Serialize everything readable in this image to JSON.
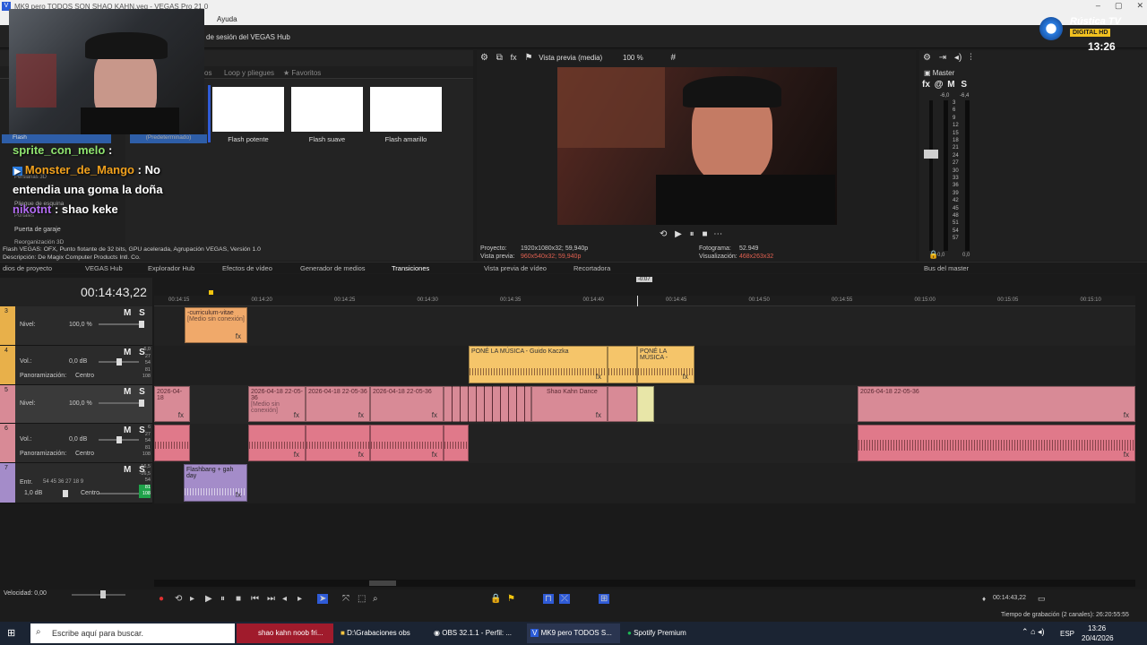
{
  "window": {
    "title": "MK9 pero TODOS SON SHAO KAHN.veg - VEGAS Pro 21.0",
    "menu_help": "Ayuda",
    "hub_text": "de sesión del VEGAS Hub"
  },
  "overlay": {
    "brand": "Rústica TV",
    "brand_sub": "DIGITAL HD",
    "clock": "13:26",
    "chat": [
      {
        "user": "sprite_con_melo",
        "text": ":"
      },
      {
        "user": "Monster_de_Mango",
        "text": ": No"
      },
      {
        "user": "",
        "text": "entendia una goma la doña"
      },
      {
        "user": "nikotnt",
        "text": ": shao keke"
      }
    ]
  },
  "transitions": {
    "tabs": [
      "os",
      "Loop y pliegues",
      "Favoritos"
    ],
    "tiles": [
      "Flash potente",
      "Flash suave",
      "Flash amarillo"
    ],
    "left_list": [
      "Flash",
      "(Predeterminado)",
      "Persianas 3D",
      "Pliegue de esquina",
      "Portales",
      "Puerta de garaje",
      "Reorganización 3D"
    ],
    "info1": "Flash VEGAS: OFX, Punto flotante de 32 bits, GPU acelerada, Agrupación VEGAS, Versión 1.0",
    "info2": "Descripción: De Magix Computer Products Intl. Co."
  },
  "tabs": {
    "bottom": [
      "dios de proyecto",
      "VEGAS Hub",
      "Explorador Hub",
      "Efectos de vídeo",
      "Generador de medios",
      "Transiciones"
    ],
    "preview": [
      "Vista previa de vídeo",
      "Recortadora"
    ],
    "master": "Bus del master"
  },
  "preview": {
    "mode": "Vista previa (media)",
    "zoom": "100 %",
    "proyecto_label": "Proyecto:",
    "proyecto_val": "1920x1080x32; 59,940p",
    "vista_label": "Vista previa:",
    "vista_val": "960x540x32; 59,940p",
    "fotograma_label": "Fotograma:",
    "fotograma_val": "52.949",
    "visual_label": "Visualización:",
    "visual_val": "468x263x32"
  },
  "master": {
    "title": "Master",
    "buttons": [
      "fx",
      "M",
      "S"
    ],
    "scale": [
      "-6,0",
      "-6,4",
      "3",
      "6",
      "9",
      "12",
      "15",
      "18",
      "21",
      "24",
      "27",
      "30",
      "33",
      "36",
      "39",
      "42",
      "45",
      "48",
      "51",
      "54",
      "57"
    ],
    "bottom": [
      "0,0",
      "0,0"
    ]
  },
  "timeline": {
    "timecode": "00:14:43,22",
    "cursor_label": "-0:07",
    "ticks": [
      "00:14:15",
      "00:14:20",
      "00:14:25",
      "00:14:30",
      "00:14:35",
      "00:14:40",
      "00:14:45",
      "00:14:50",
      "00:14:55",
      "00:15:00",
      "00:15:05",
      "00:15:10"
    ],
    "tracks": [
      {
        "num": "3",
        "kind": "video",
        "label": "Nivel:",
        "value": "100,0 %"
      },
      {
        "num": "4",
        "kind": "audio",
        "label": "Vol.:",
        "value": "0,0 dB",
        "pan_label": "Panoramización:",
        "pan": "Centro",
        "meter": [
          "-6,0",
          "27",
          "54",
          "81",
          "108"
        ]
      },
      {
        "num": "5",
        "kind": "video",
        "label": "Nivel:",
        "value": "100,0 %"
      },
      {
        "num": "6",
        "kind": "audio",
        "label": "Vol.:",
        "value": "0,0 dB",
        "pan_label": "Panoramización:",
        "pan": "Centro",
        "meter": [
          "6",
          "27",
          "54",
          "81",
          "108"
        ]
      },
      {
        "num": "7",
        "kind": "bus",
        "label": "Entr.",
        "value": "1,0 dB",
        "pan": "Centro",
        "meter": [
          "-16,5",
          "-16,5",
          "54",
          "81",
          "108"
        ]
      }
    ],
    "clips": {
      "c1": "-curriculum-vitae",
      "c1sub": "[Medio sin conexión]",
      "c2": "PONÉ LA MÚSICA - Guido Kaczka",
      "c3": "PONÉ LA MÚSICA -",
      "c4": "2026-04-18",
      "c5": "2026-04-18 22-05-36",
      "c6": "2026-04-18 22-05-36",
      "c7": "2026-04-18 22-05-36",
      "c8": "Shao Kahn Dance",
      "c9": "2026-04-18 22-05-36",
      "c10": "Flashbang + gah day",
      "nosub": "[Medio sin conexión]"
    },
    "speed_label": "Velocidad: 0,00",
    "end_time": "00:14:43,22",
    "record": "Tiempo de grabación (2 canales): 26:20:55:55"
  },
  "taskbar": {
    "search": "Escribe aquí para buscar.",
    "items": [
      "shao kahn noob fri...",
      "D:\\Grabaciones obs",
      "OBS 32.1.1 - Perfil: ...",
      "MK9 pero TODOS S...",
      "Spotify Premium"
    ],
    "lang": "ESP",
    "time": "13:26",
    "date": "20/4/2026"
  },
  "colors": {
    "accent": "#2f5bd7",
    "clip_pink": "#d88a96",
    "clip_orange": "#f0a96a",
    "clip_yellow": "#f5c56a",
    "clip_purple": "#a48cc9"
  }
}
